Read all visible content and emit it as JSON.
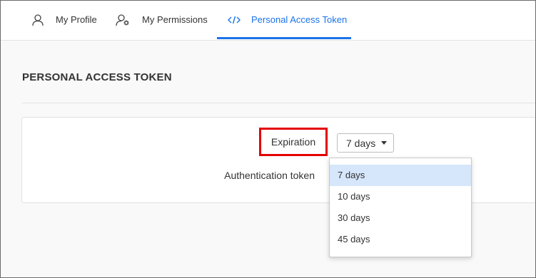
{
  "tabs": [
    {
      "label": "My Profile",
      "icon": "user-icon"
    },
    {
      "label": "My Permissions",
      "icon": "user-gear-icon"
    },
    {
      "label": "Personal Access Token",
      "icon": "code-icon"
    }
  ],
  "active_tab": "Personal Access Token",
  "section": {
    "title": "PERSONAL ACCESS TOKEN"
  },
  "form": {
    "expiration_label": "Expiration",
    "expiration_value": "7 days",
    "auth_token_label": "Authentication token"
  },
  "dropdown": {
    "options": [
      "7 days",
      "10 days",
      "30 days",
      "45 days"
    ],
    "selected": "7 days"
  },
  "colors": {
    "accent": "#1a73e8",
    "highlight_box": "#e30000",
    "selected_option_bg": "#d6e6fb"
  }
}
